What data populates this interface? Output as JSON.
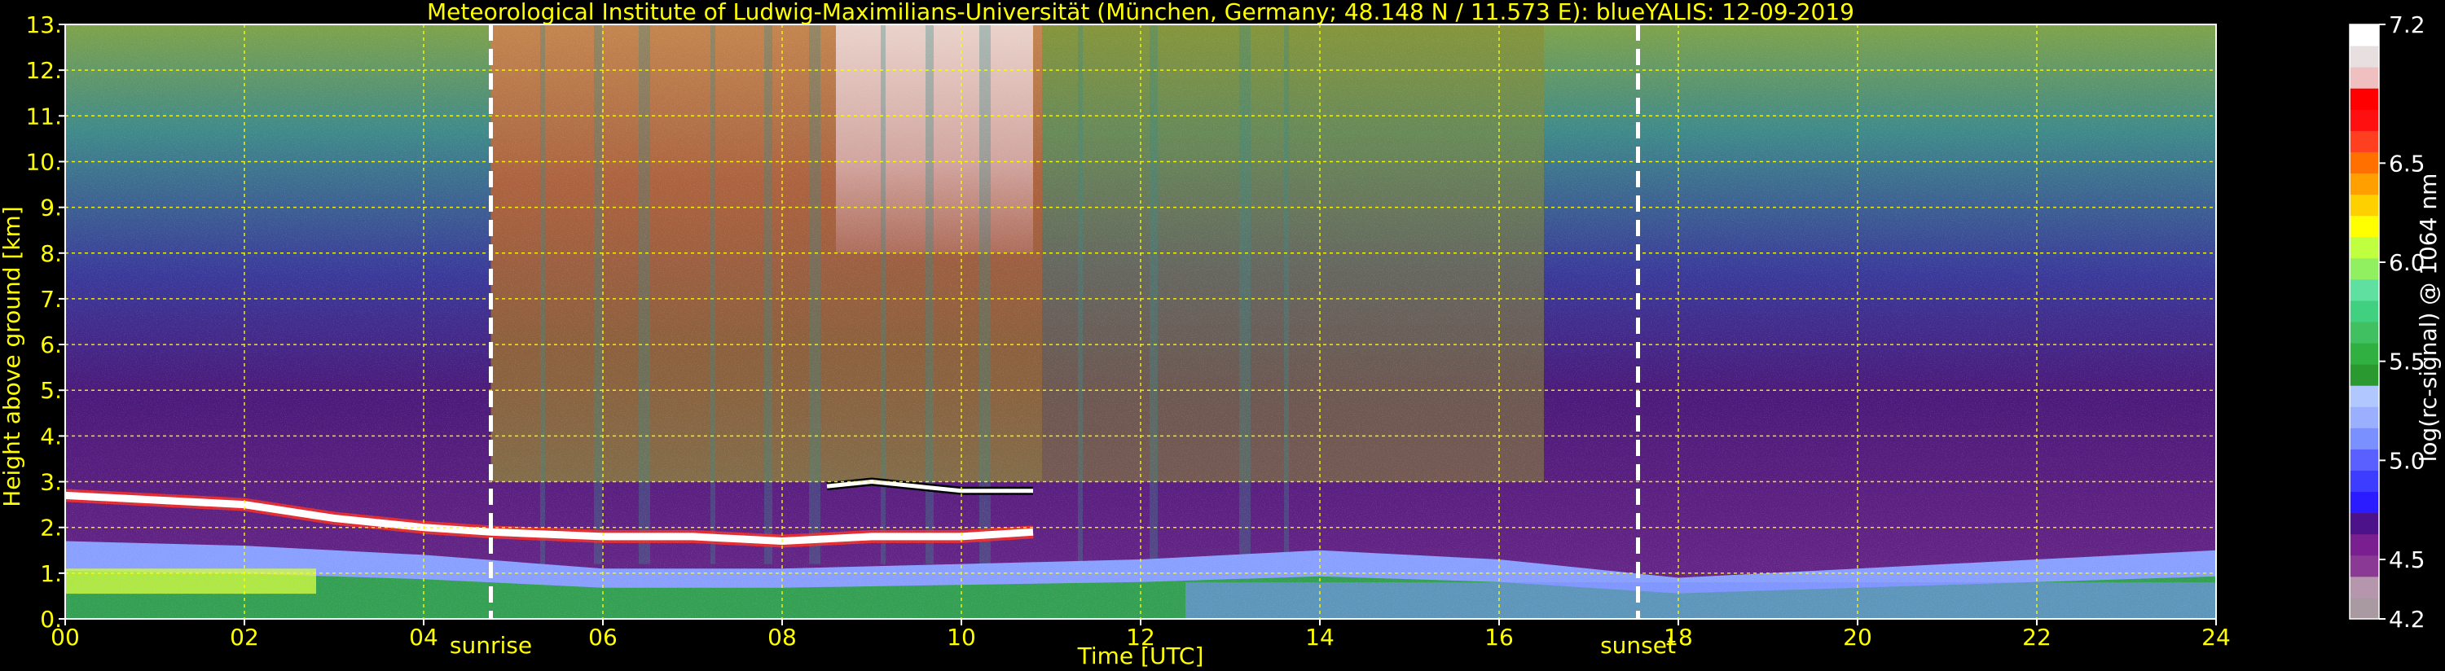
{
  "chart_data": {
    "type": "heatmap",
    "title": "Meteorological Institute of Ludwig-Maximilians-Universität (München, Germany; 48.148 N / 11.573 E):     blueYALIS: 12-09-2019",
    "xlabel": "Time [UTC]",
    "ylabel": "Height above ground [km]",
    "xlim": [
      0,
      24
    ],
    "ylim": [
      0,
      13
    ],
    "x_ticks": [
      "00",
      "02",
      "04",
      "06",
      "08",
      "10",
      "12",
      "14",
      "16",
      "18",
      "20",
      "22",
      "24"
    ],
    "y_ticks": [
      "0.",
      "1.",
      "2.",
      "3.",
      "4.",
      "5.",
      "6.",
      "7.",
      "8.",
      "9.",
      "10.",
      "11.",
      "12.",
      "13."
    ],
    "grid": true,
    "annotations": [
      {
        "label": "sunrise",
        "x": 4.75
      },
      {
        "label": "sunset",
        "x": 17.55
      }
    ],
    "colorbar": {
      "label": "log(rc-signal) @ 1064 nm",
      "range": [
        4.2,
        7.2
      ],
      "ticks": [
        "4.2",
        "4.5",
        "5.0",
        "5.5",
        "6.0",
        "6.5",
        "7.2"
      ],
      "colors": [
        "#a89aa0",
        "#b596ad",
        "#8a3a95",
        "#7a1f8f",
        "#4b128a",
        "#2a1cff",
        "#3d3dff",
        "#5a60ff",
        "#7a90ff",
        "#9ab0ff",
        "#b0c8ff",
        "#2a9a30",
        "#30b040",
        "#40c060",
        "#40d080",
        "#60e0a0",
        "#90f060",
        "#c0ff40",
        "#ffff00",
        "#ffd000",
        "#ffa000",
        "#ff7000",
        "#ff4020",
        "#ff1010",
        "#ff0000",
        "#f0c0c0",
        "#e8e0e0",
        "#ffffff"
      ]
    },
    "features": [
      {
        "name": "aerosol layer top",
        "x": [
          0,
          1,
          2,
          3,
          4,
          4.75,
          6,
          7,
          8,
          9,
          10,
          10.8
        ],
        "y": [
          2.7,
          2.6,
          2.5,
          2.2,
          2.0,
          1.9,
          1.8,
          1.8,
          1.7,
          1.8,
          1.8,
          1.9
        ]
      },
      {
        "name": "elevated thin layer",
        "x": [
          8.5,
          9,
          9.5,
          10,
          10.8
        ],
        "y": [
          2.9,
          3.0,
          2.9,
          2.8,
          2.8
        ]
      },
      {
        "name": "boundary layer height",
        "x": [
          0,
          2,
          4,
          6,
          8,
          10,
          12,
          14,
          16,
          18,
          20,
          22,
          24
        ],
        "y": [
          1.7,
          1.6,
          1.4,
          1.1,
          1.1,
          1.2,
          1.3,
          1.5,
          1.3,
          0.9,
          1.1,
          1.3,
          1.5
        ]
      }
    ]
  }
}
